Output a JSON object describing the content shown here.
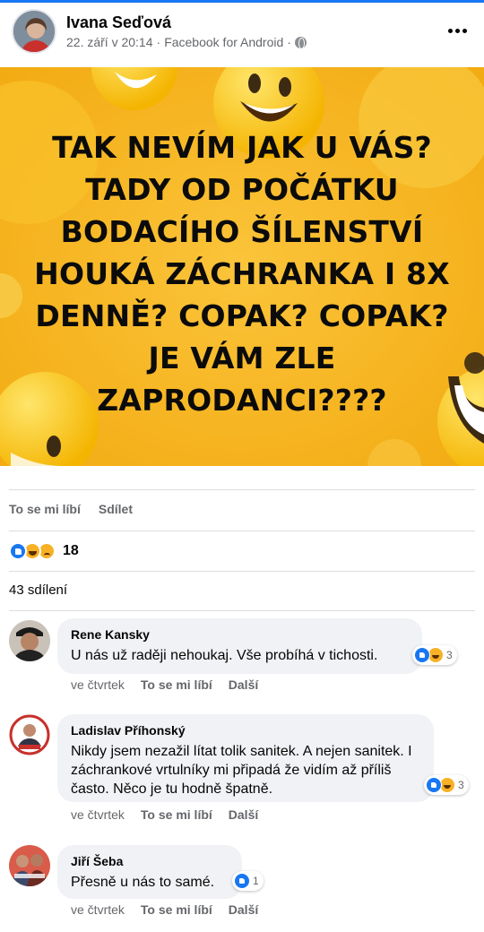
{
  "post": {
    "author": "Ivana Seďová",
    "date": "22. září v 20:14",
    "separator": "·",
    "source": "Facebook for Android",
    "image_text": "TAK NEVÍM JAK U VÁS? TADY OD POČÁTKU BODACÍHO ŠÍLENSTVÍ HOUKÁ ZÁCHRANKA I 8X DENNĚ? COPAK? COPAK? JE VÁM ZLE ZAPRODANCI????",
    "image_bg_color": "#f7b519",
    "icons": [
      "globe-icon",
      "more-options-icon",
      "like-reaction-icon",
      "haha-reaction-icon",
      "sad-reaction-icon"
    ]
  },
  "actions": {
    "like_label": "To se mi líbí",
    "share_label": "Sdílet"
  },
  "reactions": {
    "count": "18"
  },
  "shares": {
    "label": "43 sdílení"
  },
  "comments": [
    {
      "name": "Rene Kansky",
      "text": "U nás už raději nehoukaj. Vše probíhá v tichosti.",
      "reaction_count": "3",
      "time": "ve čtvrtek",
      "like_label": "To se mi líbí",
      "more_label": "Další"
    },
    {
      "name": "Ladislav Příhonský",
      "text": "Nikdy jsem nezažil lítat tolik sanitek. A nejen sanitek. I záchrankové vrtulníky mi připadá že vidím až příliš často. Něco je tu hodně špatně.",
      "reaction_count": "3",
      "time": "ve čtvrtek",
      "like_label": "To se mi líbí",
      "more_label": "Další"
    },
    {
      "name": "Jiří Šeba",
      "text": "Přesně u nás to samé.",
      "reaction_count": "1",
      "time": "ve čtvrtek",
      "like_label": "To se mi líbí",
      "more_label": "Další"
    }
  ],
  "colors": {
    "accent": "#1877f2",
    "secondary_text": "#65676b",
    "bubble": "#f0f2f5"
  }
}
